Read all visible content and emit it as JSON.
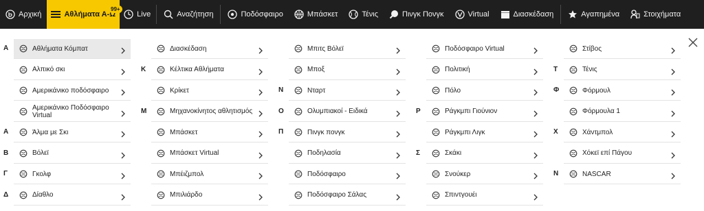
{
  "nav": {
    "home": "Αρχική",
    "sports_az": "Αθλήματα Α-Ω",
    "live": "Live",
    "live_badge": "99+",
    "search": "Αναζήτηση",
    "football": "Ποδόσφαιρο",
    "basketball": "Μπάσκετ",
    "tennis": "Τένις",
    "pingpong": "Πινγκ Πονγκ",
    "virtual": "Virtual",
    "entertainment": "Διασκέδαση",
    "favorites": "Αγαπημένα",
    "bets": "Στοιχήματα"
  },
  "columns": [
    [
      {
        "letter": "Α",
        "label": "Αθλήματα Κόμπατ",
        "icon": "combat-icon",
        "selected": true
      },
      {
        "letter": "",
        "label": "Αλπικό σκι",
        "icon": "ski-boot-icon"
      },
      {
        "letter": "",
        "label": "Αμερικάνικο ποδόσφαιρο",
        "icon": "american-football-icon"
      },
      {
        "letter": "",
        "label": "Αμερικάνικο Ποδόσφαιρο Virtual",
        "icon": "virtual-american-football-icon"
      },
      {
        "letter": "Α",
        "label": "Άλμα με Σκι",
        "icon": "ski-jump-icon"
      },
      {
        "letter": "Β",
        "label": "Βόλεϊ",
        "icon": "volleyball-icon"
      },
      {
        "letter": "Γ",
        "label": "Γκολφ",
        "icon": "golf-icon"
      },
      {
        "letter": "Δ",
        "label": "Δίαθλο",
        "icon": "biathlon-icon"
      }
    ],
    [
      {
        "letter": "",
        "label": "Διασκέδαση",
        "icon": "clapperboard-icon"
      },
      {
        "letter": "Κ",
        "label": "Κέλτικα Αθλήματα",
        "icon": "celtic-icon"
      },
      {
        "letter": "",
        "label": "Κρίκετ",
        "icon": "cricket-icon"
      },
      {
        "letter": "Μ",
        "label": "Μηχανοκίνητος αθλητισμός",
        "icon": "motorsport-icon"
      },
      {
        "letter": "",
        "label": "Μπάσκετ",
        "icon": "basketball-icon"
      },
      {
        "letter": "",
        "label": "Μπάσκετ Virtual",
        "icon": "virtual-basketball-icon"
      },
      {
        "letter": "",
        "label": "Μπέιζμπολ",
        "icon": "baseball-icon"
      },
      {
        "letter": "",
        "label": "Μπιλιάρδο",
        "icon": "billiards-icon"
      }
    ],
    [
      {
        "letter": "",
        "label": "Μπιτς Βόλεϊ",
        "icon": "beach-volley-icon"
      },
      {
        "letter": "",
        "label": "Μποξ",
        "icon": "boxing-icon"
      },
      {
        "letter": "Ν",
        "label": "Νταρτ",
        "icon": "darts-icon"
      },
      {
        "letter": "Ο",
        "label": "Ολυμπιακοί - Ειδικά",
        "icon": "olympics-icon"
      },
      {
        "letter": "Π",
        "label": "Πινγκ πονγκ",
        "icon": "ping-pong-icon"
      },
      {
        "letter": "",
        "label": "Ποδηλασία",
        "icon": "cycling-icon"
      },
      {
        "letter": "",
        "label": "Ποδόσφαιρο",
        "icon": "football-icon"
      },
      {
        "letter": "",
        "label": "Ποδόσφαιρο Σάλας",
        "icon": "futsal-icon"
      }
    ],
    [
      {
        "letter": "",
        "label": "Ποδόσφαιρο Virtual",
        "icon": "virtual-football-icon"
      },
      {
        "letter": "",
        "label": "Πολιτική",
        "icon": "politics-icon"
      },
      {
        "letter": "",
        "label": "Πόλο",
        "icon": "polo-icon"
      },
      {
        "letter": "Ρ",
        "label": "Ράγκμπι Γιούνιον",
        "icon": "rugby-union-icon"
      },
      {
        "letter": "",
        "label": "Ράγκμπι Λιγκ",
        "icon": "rugby-league-icon"
      },
      {
        "letter": "Σ",
        "label": "Σκάκι",
        "icon": "chess-icon"
      },
      {
        "letter": "",
        "label": "Σνούκερ",
        "icon": "snooker-icon"
      },
      {
        "letter": "",
        "label": "Σπιντγουέι",
        "icon": "speedway-icon"
      }
    ],
    [
      {
        "letter": "",
        "label": "Στίβος",
        "icon": "athletics-icon"
      },
      {
        "letter": "Τ",
        "label": "Τένις",
        "icon": "tennis-icon"
      },
      {
        "letter": "Φ",
        "label": "Φόρμουλ",
        "icon": "formula-icon"
      },
      {
        "letter": "",
        "label": "Φόρμουλα 1",
        "icon": "formula-1-icon"
      },
      {
        "letter": "Χ",
        "label": "Χάντμπολ",
        "icon": "handball-icon"
      },
      {
        "letter": "",
        "label": "Χόκεϊ επί Πάγου",
        "icon": "ice-hockey-icon"
      },
      {
        "letter": "Ν",
        "label": "NASCAR",
        "icon": "nascar-icon"
      }
    ]
  ],
  "colors": {
    "accent": "#f7c800",
    "topbar": "#1f1f1f",
    "selected": "#e9e9e9",
    "divider": "#e3e3e3"
  }
}
